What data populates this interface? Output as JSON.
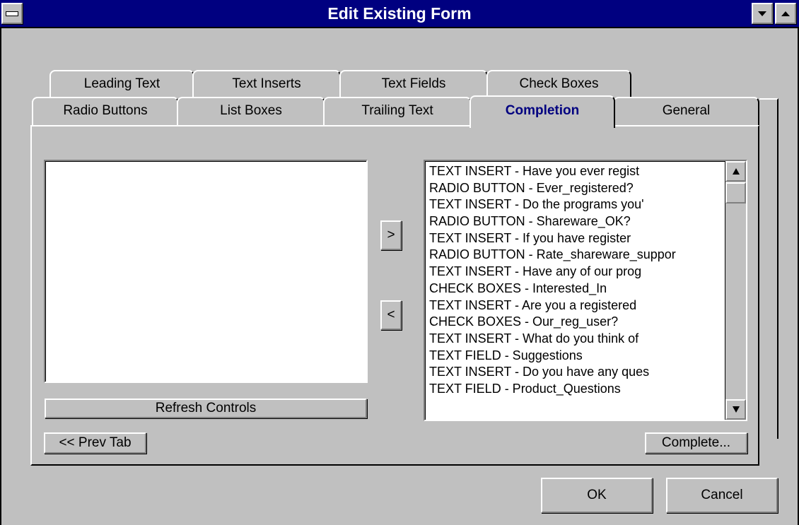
{
  "window": {
    "title": "Edit Existing Form"
  },
  "tabs": {
    "back_row": [
      "Leading Text",
      "Text Inserts",
      "Text Fields",
      "Check Boxes"
    ],
    "front_row": [
      "Radio Buttons",
      "List Boxes",
      "Trailing Text",
      "Completion",
      "General"
    ],
    "active": "Completion"
  },
  "buttons": {
    "move_right": ">",
    "move_left": "<",
    "refresh": "Refresh Controls",
    "prev_tab": "<< Prev Tab",
    "complete": "Complete...",
    "ok": "OK",
    "cancel": "Cancel"
  },
  "available_list": {
    "items": [
      "TEXT INSERT  - Have you ever regist",
      "RADIO BUTTON - Ever_registered?",
      "TEXT INSERT  - Do the programs you'",
      "RADIO BUTTON - Shareware_OK?",
      "TEXT INSERT  - If you have register",
      "RADIO BUTTON - Rate_shareware_suppor",
      "TEXT INSERT  - Have any of our prog",
      "CHECK BOXES  - Interested_In",
      "TEXT INSERT  - Are you a registered",
      "CHECK BOXES  - Our_reg_user?",
      "TEXT INSERT  - What do you think of",
      "TEXT FIELD   - Suggestions",
      "TEXT INSERT  - Do you have any ques",
      "TEXT FIELD   - Product_Questions"
    ]
  },
  "icons": {
    "system_menu": "system-menu-icon",
    "minimize": "minimize-arrow-icon",
    "maximize": "maximize-arrow-icon",
    "scroll_up": "scroll-up-arrow-icon",
    "scroll_down": "scroll-down-arrow-icon"
  },
  "colors": {
    "titlebar": "#000080",
    "face": "#c0c0c0",
    "active_tab_text": "#000080"
  }
}
